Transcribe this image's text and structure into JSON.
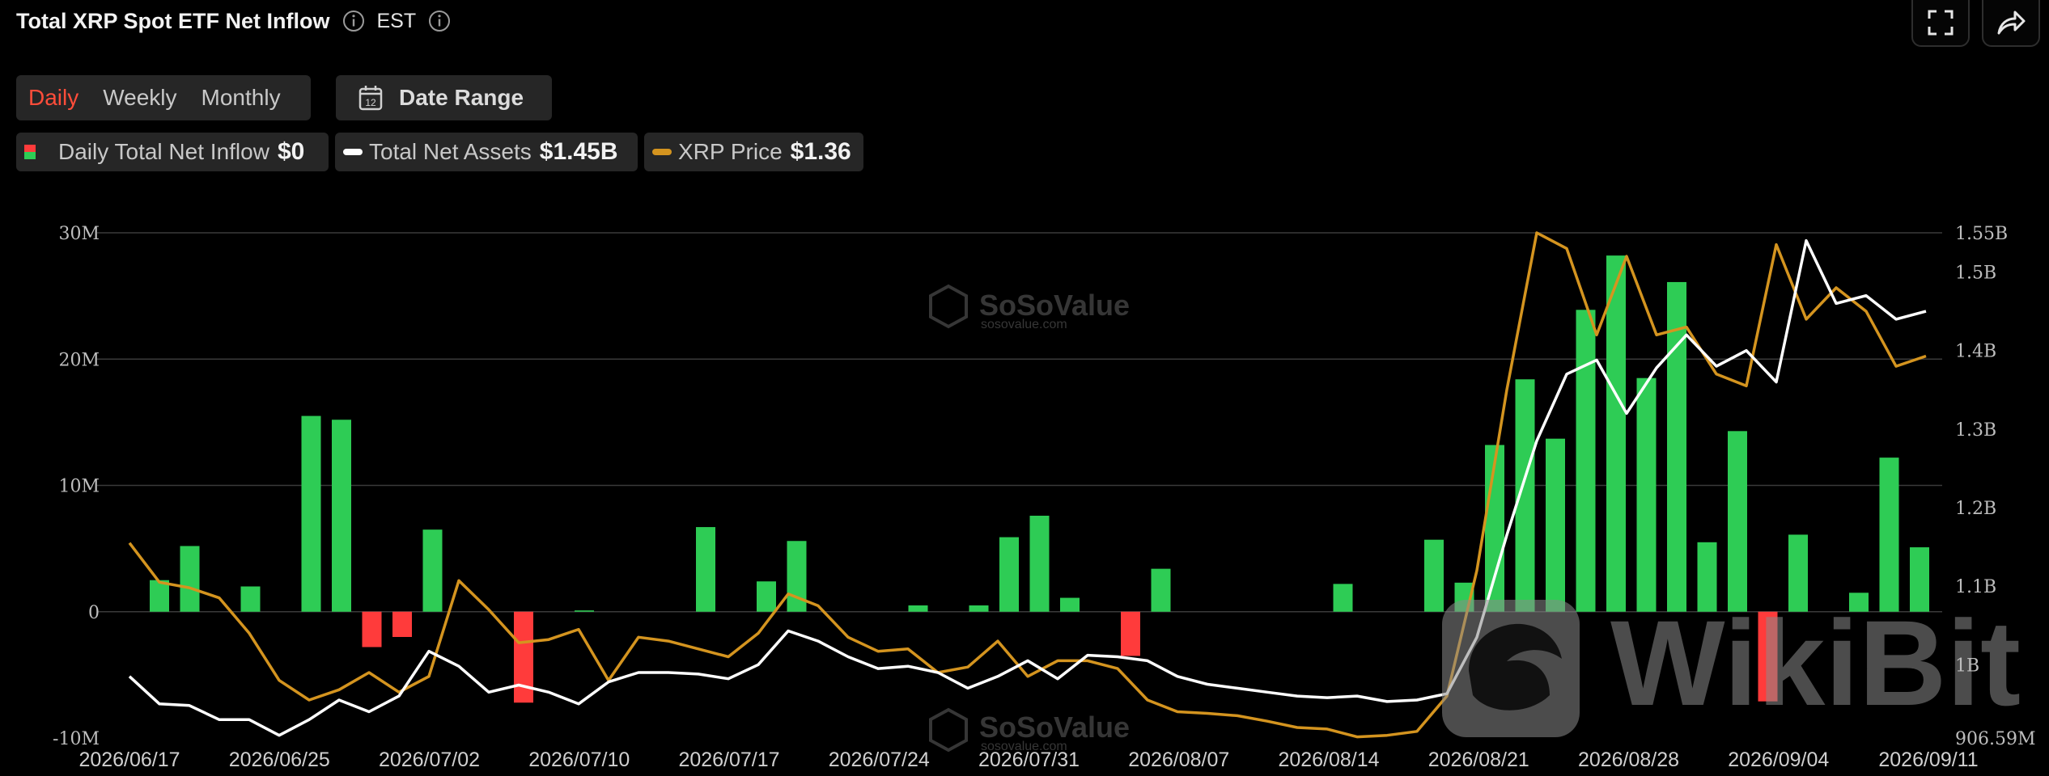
{
  "header": {
    "title": "Total XRP Spot ETF Net Inflow",
    "timezone": "EST"
  },
  "period_tabs": [
    {
      "label": "Daily",
      "active": true
    },
    {
      "label": "Weekly",
      "active": false
    },
    {
      "label": "Monthly",
      "active": false
    }
  ],
  "date_range": {
    "label": "Date Range",
    "calendar_day": "12"
  },
  "legend": {
    "inflow": {
      "label": "Daily Total Net Inflow",
      "value": "$0"
    },
    "assets": {
      "label": "Total Net Assets",
      "value": "$1.45B"
    },
    "price": {
      "label": "XRP Price",
      "value": "$1.36"
    }
  },
  "watermarks": {
    "brand": "SoSoValue",
    "domain": "sosovalue.com",
    "overlay_brand": "WikiBit"
  },
  "colors": {
    "positive": "#2ecc55",
    "negative": "#ff3b3b",
    "assets_line": "#ffffff",
    "price_line": "#d4941f",
    "active_tab": "#ff4d3a",
    "grid": "#3a3a3a"
  },
  "chart_data": {
    "type": "bar",
    "left_axis": {
      "ticks": [
        -10,
        0,
        10,
        20,
        30
      ],
      "tick_labels": [
        "-10M",
        "0",
        "10M",
        "20M",
        "30M"
      ],
      "range": [
        -10,
        30
      ],
      "unit": "M"
    },
    "right_axis": {
      "tick_labels": [
        "906.59M",
        "1B",
        "1.1B",
        "1.2B",
        "1.3B",
        "1.4B",
        "1.5B",
        "1.55B"
      ],
      "ticks": [
        0.90659,
        1.0,
        1.1,
        1.2,
        1.3,
        1.4,
        1.5,
        1.55
      ],
      "range": [
        0.90659,
        1.55
      ],
      "unit": "B"
    },
    "x_tick_labels": [
      "2026/06/17",
      "2026/06/25",
      "2026/07/02",
      "2026/07/10",
      "2026/07/17",
      "2026/07/24",
      "2026/07/31",
      "2026/08/07",
      "2026/08/14",
      "2026/08/21",
      "2026/08/28",
      "2026/09/04",
      "2026/09/11"
    ],
    "series": [
      {
        "values": [
          2.5,
          5.2,
          0,
          2.0,
          0,
          15.5,
          15.2,
          -2.8,
          -2.0,
          6.5,
          0,
          0,
          -7.2,
          0,
          0.1,
          0,
          0,
          0,
          6.7,
          0,
          2.4,
          5.6,
          0,
          0,
          0,
          0.5,
          0,
          0.5,
          5.9,
          7.6,
          1.1,
          0,
          -3.5,
          3.4,
          0,
          0,
          0,
          0,
          0,
          2.2,
          0,
          0,
          5.7,
          2.3,
          13.2,
          18.4,
          13.7,
          23.9,
          28.2,
          18.5,
          26.1,
          5.5,
          14.3,
          -7.1,
          6.1,
          0,
          1.5,
          12.2,
          5.1
        ]
      },
      {
        "name": "Total Net Assets",
        "values": [
          0.985,
          0.95,
          0.948,
          0.93,
          0.93,
          0.91,
          0.93,
          0.955,
          0.94,
          0.96,
          1.017,
          0.998,
          0.965,
          0.974,
          0.965,
          0.95,
          0.978,
          0.99,
          0.99,
          0.988,
          0.982,
          1.0,
          1.043,
          1.03,
          1.01,
          0.995,
          0.998,
          0.99,
          0.97,
          0.985,
          1.005,
          0.982,
          1.012,
          1.01,
          1.005,
          0.985,
          0.975,
          0.97,
          0.965,
          0.96,
          0.958,
          0.96,
          0.953,
          0.955,
          0.963,
          1.035,
          1.165,
          1.285,
          1.37,
          1.388,
          1.32,
          1.378,
          1.42,
          1.38,
          1.4,
          1.36,
          1.54,
          1.46,
          1.47,
          1.44,
          1.45
        ]
      },
      {
        "name": "XRP Price",
        "values": [
          1.155,
          1.105,
          1.098,
          1.085,
          1.04,
          0.98,
          0.955,
          0.968,
          0.99,
          0.965,
          0.985,
          1.107,
          1.07,
          1.028,
          1.032,
          1.045,
          0.98,
          1.035,
          1.03,
          1.02,
          1.01,
          1.04,
          1.09,
          1.075,
          1.035,
          1.017,
          1.02,
          0.99,
          0.997,
          1.03,
          0.985,
          1.005,
          1.005,
          0.995,
          0.955,
          0.94,
          0.938,
          0.935,
          0.928,
          0.92,
          0.918,
          0.908,
          0.91,
          0.915,
          0.96,
          1.12,
          1.35,
          1.55,
          1.53,
          1.42,
          1.52,
          1.42,
          1.43,
          1.37,
          1.355,
          1.535,
          1.44,
          1.48,
          1.45,
          1.38,
          1.393
        ]
      }
    ]
  }
}
